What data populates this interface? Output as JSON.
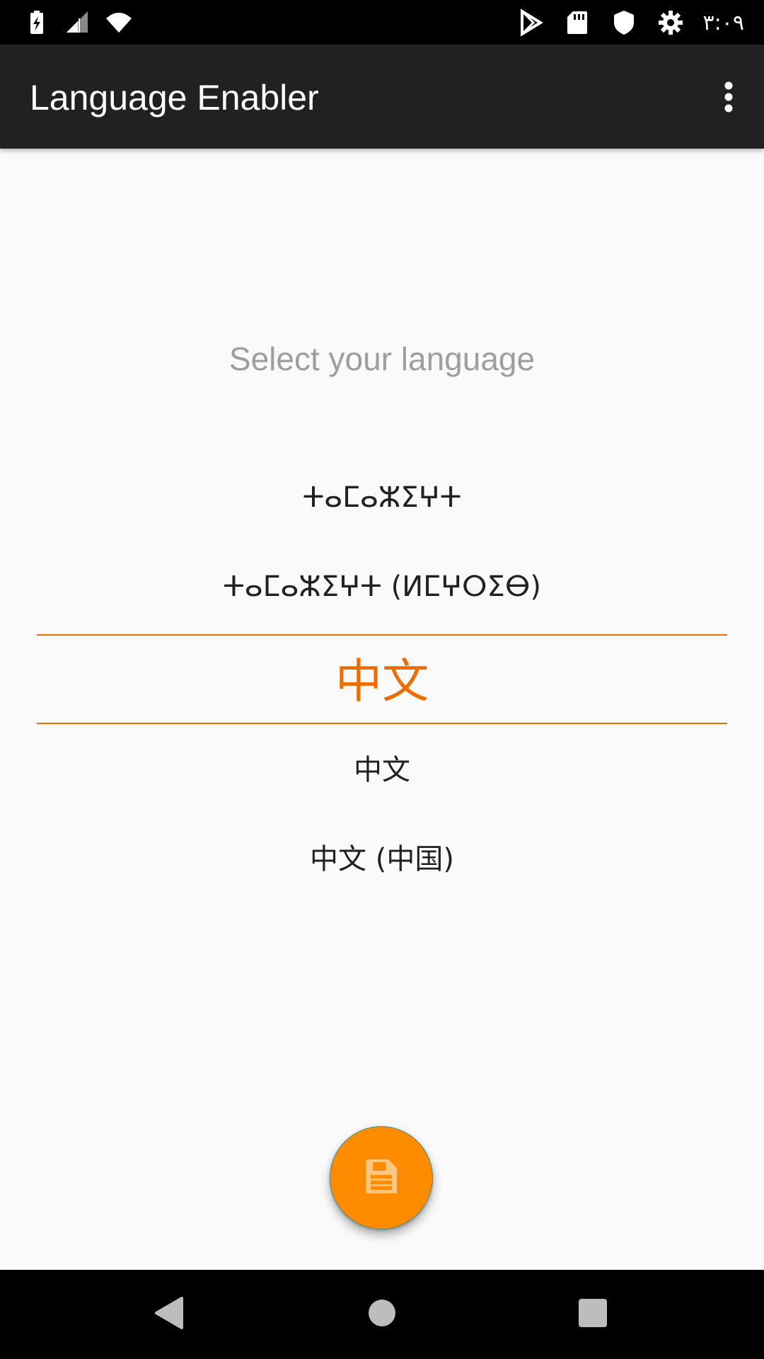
{
  "status_bar": {
    "time": "۳:۰۹",
    "icons": [
      "battery-charging-icon",
      "cellular-signal-icon",
      "wifi-icon",
      "play-store-icon",
      "sd-card-icon",
      "shield-icon",
      "settings-gear-icon"
    ]
  },
  "app_bar": {
    "title": "Language Enabler",
    "overflow_icon": "more-vert-icon"
  },
  "main": {
    "prompt": "Select your language",
    "languages": [
      "ⵜⴰⵎⴰⵣⵉⵖⵜ",
      "ⵜⴰⵎⴰⵣⵉⵖⵜ (ⵍⵎⵖⵔⵉⴱ)",
      "中文",
      "中文",
      "中文 (中国)"
    ],
    "selected_index": 2
  },
  "fab": {
    "icon": "save-floppy-icon",
    "color": "#ff8c00"
  },
  "colors": {
    "accent": "#ef6c00",
    "app_bar": "#212121",
    "background": "#fafafa"
  },
  "nav_bar": {
    "icons": [
      "back-triangle-icon",
      "home-circle-icon",
      "recents-square-icon"
    ]
  }
}
